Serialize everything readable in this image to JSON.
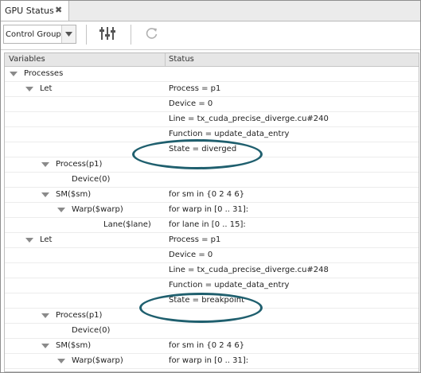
{
  "tab": {
    "title": "GPU Status",
    "close_glyph": "✖"
  },
  "toolbar": {
    "combo_value": "Control Group",
    "icons": [
      "columns-settings-icon",
      "refresh-icon"
    ]
  },
  "table": {
    "columns": [
      "Variables",
      "Status"
    ],
    "rows": [
      {
        "var": "Processes",
        "status": "",
        "depth": 0,
        "expander": true
      },
      {
        "var": "Let",
        "status": "Process = p1",
        "depth": 1,
        "expander": true
      },
      {
        "var": "",
        "status": "Device = 0",
        "depth": 2,
        "expander": false
      },
      {
        "var": "",
        "status": "Line = tx_cuda_precise_diverge.cu#240",
        "depth": 2,
        "expander": false
      },
      {
        "var": "",
        "status": "Function = update_data_entry",
        "depth": 2,
        "expander": false
      },
      {
        "var": "",
        "status": "State = diverged",
        "depth": 2,
        "expander": false
      },
      {
        "var": "Process(p1)",
        "status": "",
        "depth": 2,
        "expander": true
      },
      {
        "var": "Device(0)",
        "status": "",
        "depth": 3,
        "expander": false
      },
      {
        "var": "SM($sm)",
        "status": "for sm in {0 2 4 6}",
        "depth": 2,
        "expander": true
      },
      {
        "var": "Warp($warp)",
        "status": "for warp in [0 .. 31]:",
        "depth": 3,
        "expander": true
      },
      {
        "var": "Lane($lane)",
        "status": "for lane in [0 .. 15]:",
        "depth": 5,
        "expander": false
      },
      {
        "var": "Let",
        "status": "Process = p1",
        "depth": 1,
        "expander": true
      },
      {
        "var": "",
        "status": "Device = 0",
        "depth": 2,
        "expander": false
      },
      {
        "var": "",
        "status": "Line = tx_cuda_precise_diverge.cu#248",
        "depth": 2,
        "expander": false
      },
      {
        "var": "",
        "status": "Function = update_data_entry",
        "depth": 2,
        "expander": false
      },
      {
        "var": "",
        "status": "State = breakpoint",
        "depth": 2,
        "expander": false
      },
      {
        "var": "Process(p1)",
        "status": "",
        "depth": 2,
        "expander": true
      },
      {
        "var": "Device(0)",
        "status": "",
        "depth": 3,
        "expander": false
      },
      {
        "var": "SM($sm)",
        "status": "for sm in {0 2 4 6}",
        "depth": 2,
        "expander": true
      },
      {
        "var": "Warp($warp)",
        "status": "for warp in [0 .. 31]:",
        "depth": 3,
        "expander": true
      }
    ]
  },
  "colors": {
    "callout_ellipse": "#1f5f6e",
    "expander": "#8a8a8a",
    "header_bg": "#e6e6e6"
  }
}
